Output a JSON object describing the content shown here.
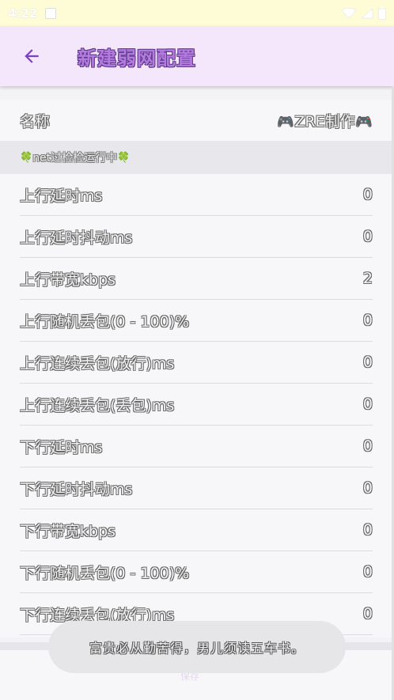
{
  "status_bar": {
    "time": "4:22"
  },
  "app_bar": {
    "title": "新建弱网配置"
  },
  "name_row": {
    "label": "名称",
    "value_prefix": "🎮",
    "value": "ZRE制作",
    "value_suffix": "🎮"
  },
  "section": {
    "prefix": "🍀",
    "label": "net过检检运行中",
    "suffix": "🍀"
  },
  "rows": [
    {
      "label": "上行延时ms",
      "value": "0"
    },
    {
      "label": "上行延时抖动ms",
      "value": "0"
    },
    {
      "label": "上行带宽kbps",
      "value": "2"
    },
    {
      "label": "上行随机丢包(0 - 100)%",
      "value": "0"
    },
    {
      "label": "上行连续丢包(放行)ms",
      "value": "0"
    },
    {
      "label": "上行连续丢包(丢包)ms",
      "value": "0"
    },
    {
      "label": "下行延时ms",
      "value": "0"
    },
    {
      "label": "下行延时抖动ms",
      "value": "0"
    },
    {
      "label": "下行带宽kbps",
      "value": "0"
    },
    {
      "label": "下行随机丢包(0 - 100)%",
      "value": "0"
    },
    {
      "label": "下行连续丢包(放行)ms",
      "value": "0"
    }
  ],
  "toast": {
    "text": "富贵必从勤苦得，男儿须读五车书。"
  },
  "footer": {
    "text": "保存"
  },
  "colors": {
    "appbar": "#f4e6fb",
    "accent": "#7b3fc2",
    "status_bar": "#fdfcd6"
  }
}
